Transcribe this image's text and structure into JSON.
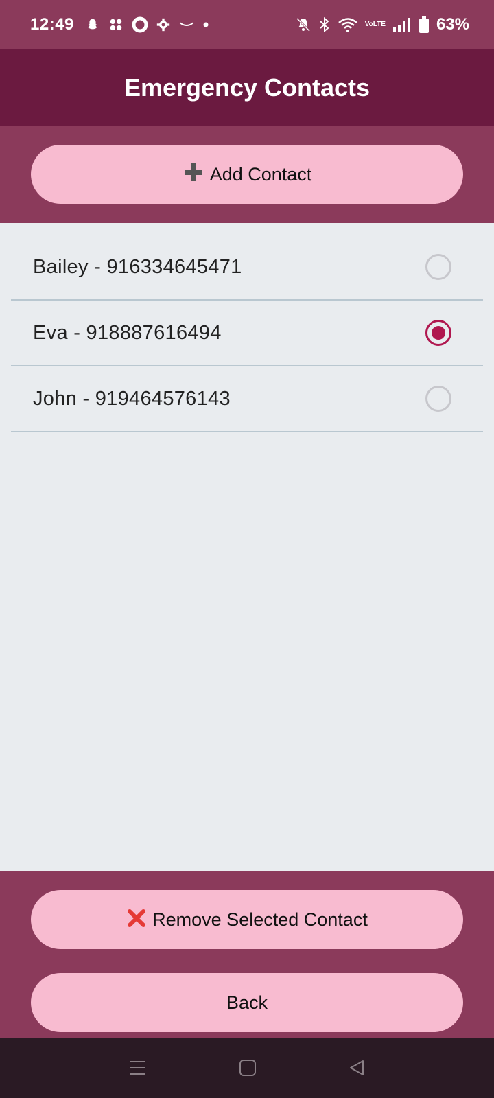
{
  "status_bar": {
    "time": "12:49",
    "battery": "63%",
    "network_label_top": "Vo",
    "network_label_bottom": "LTE",
    "icons": [
      "snapchat-icon",
      "clover-icon",
      "circle-icon",
      "gear-icon",
      "smile-icon",
      "dot-icon",
      "mute-bell-icon",
      "bluetooth-icon",
      "wifi-icon",
      "volte-icon",
      "signal-icon",
      "battery-icon"
    ]
  },
  "header": {
    "title": "Emergency Contacts"
  },
  "actions": {
    "add_label": "Add Contact",
    "add_icon": "➕",
    "remove_label": "Remove Selected Contact",
    "remove_icon": "❌",
    "back_label": "Back"
  },
  "contacts": [
    {
      "label": "Bailey - 916334645471",
      "selected": false
    },
    {
      "label": "Eva - 918887616494",
      "selected": true
    },
    {
      "label": "John - 919464576143",
      "selected": false
    }
  ],
  "colors": {
    "primary_dark": "#6B1A40",
    "primary": "#8B3A5B",
    "button_pink": "#F8BBD0",
    "list_background": "#E9ECEF",
    "radio_selected": "#B0174F",
    "nav_bar": "#2A1A24"
  },
  "nav_bar": {
    "icons": [
      "menu-icon",
      "home-icon",
      "back-triangle-icon"
    ]
  }
}
